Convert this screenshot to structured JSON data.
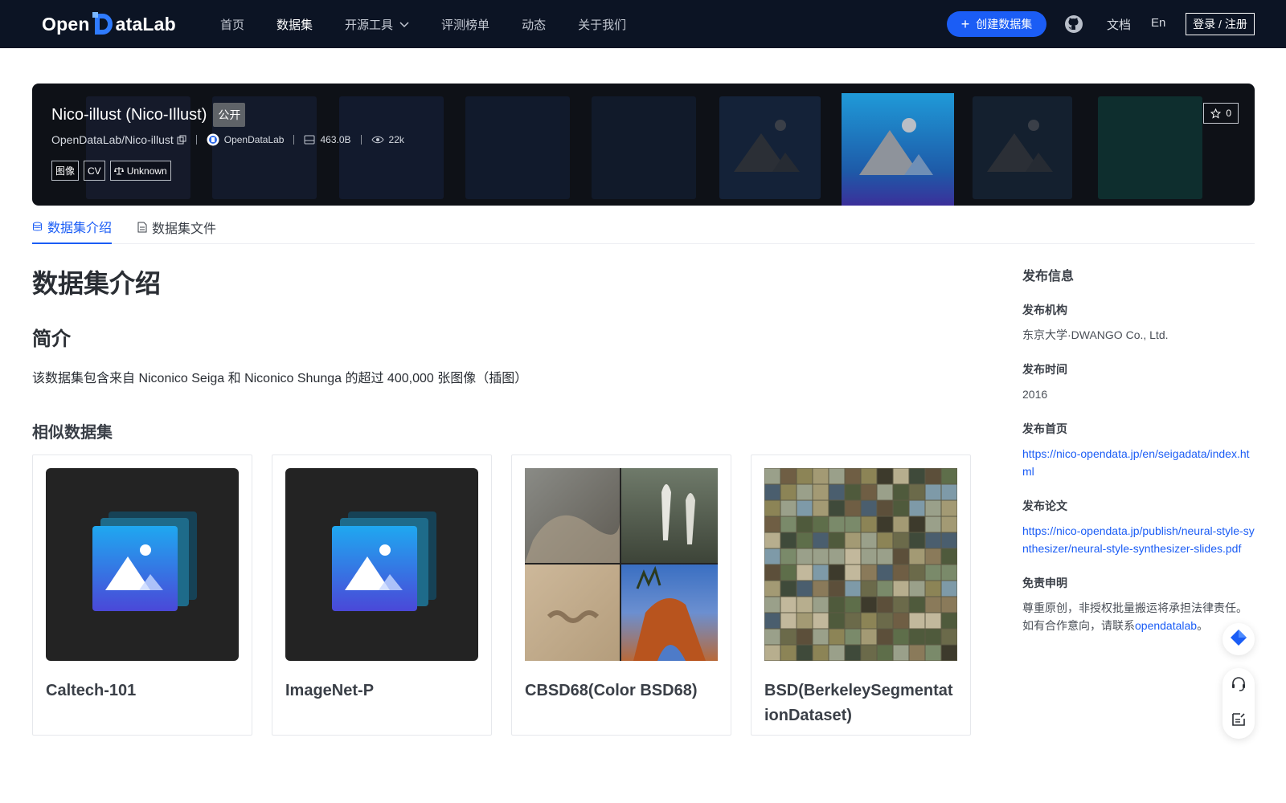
{
  "brand": {
    "logo_part1": "Open",
    "logo_part2": "ataLab"
  },
  "nav": {
    "items": [
      {
        "label": "首页"
      },
      {
        "label": "数据集"
      },
      {
        "label": "开源工具"
      },
      {
        "label": "评测榜单"
      },
      {
        "label": "动态"
      },
      {
        "label": "关于我们"
      }
    ],
    "create_label": "创建数据集",
    "docs_label": "文档",
    "lang_label": "En",
    "login_label": "登录 / 注册"
  },
  "banner": {
    "title": "Nico-illust (Nico-Illust)",
    "visibility": "公开",
    "repo": "OpenDataLab/Nico-illust",
    "owner": "OpenDataLab",
    "size": "463.0B",
    "views": "22k",
    "tags": [
      "图像",
      "CV"
    ],
    "license": "Unknown",
    "stars": "0"
  },
  "tabs": [
    {
      "label": "数据集介绍"
    },
    {
      "label": "数据集文件"
    }
  ],
  "main": {
    "heading": "数据集介绍",
    "intro_heading": "简介",
    "intro_text": "该数据集包含来自 Niconico Seiga 和 Niconico Shunga 的超过 400,000 张图像（插图）",
    "similar_heading": "相似数据集",
    "similar": [
      {
        "title": "Caltech-101",
        "thumb": "placeholder-image-icon"
      },
      {
        "title": "ImageNet-P",
        "thumb": "placeholder-image-icon"
      },
      {
        "title": "CBSD68(Color BSD68)",
        "thumb": "photo-collage"
      },
      {
        "title": "BSD(BerkeleySegmentationDataset)",
        "thumb": "photo-mosaic"
      }
    ]
  },
  "side": {
    "title": "发布信息",
    "org_label": "发布机构",
    "org": "东京大学·DWANGO Co., Ltd.",
    "time_label": "发布时间",
    "time": "2016",
    "home_label": "发布首页",
    "home": "https://nico-opendata.jp/en/seigadata/index.html",
    "paper_label": "发布论文",
    "paper": "https://nico-opendata.jp/publish/neural-style-synthesizer/neural-style-synthesizer-slides.pdf",
    "disclaimer_label": "免责申明",
    "disclaimer_text": "尊重原创，非授权批量搬运将承担法律责任。如有合作意向，请联系",
    "disclaimer_link": "opendatalab",
    "disclaimer_end": "。"
  },
  "colors": {
    "nav_bg": "#0c1424",
    "accent": "#1b5df5",
    "banner_bg": "#0e1117"
  }
}
